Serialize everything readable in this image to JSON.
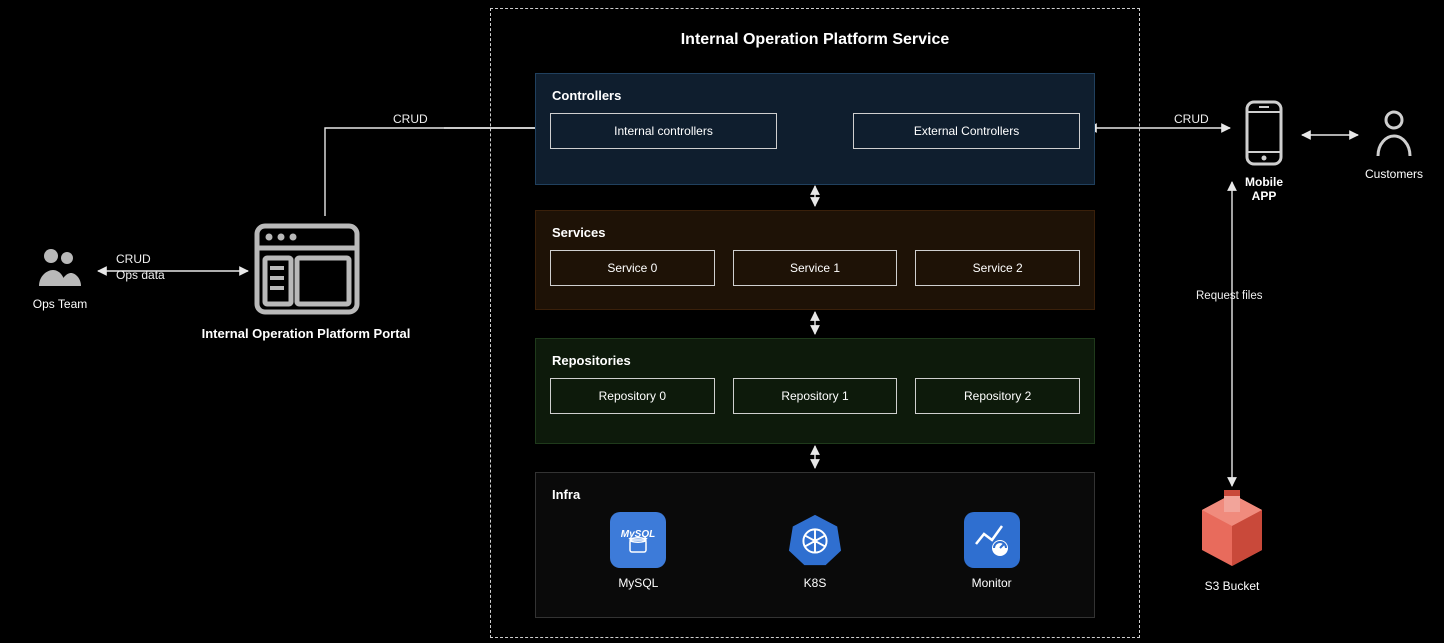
{
  "title": "Internal Operation Platform Service",
  "layers": {
    "controllers": {
      "title": "Controllers",
      "items": [
        "Internal controllers",
        "External Controllers"
      ]
    },
    "services": {
      "title": "Services",
      "items": [
        "Service 0",
        "Service 1",
        "Service 2"
      ]
    },
    "repositories": {
      "title": "Repositories",
      "items": [
        "Repository 0",
        "Repository 1",
        "Repository 2"
      ]
    },
    "infra": {
      "title": "Infra",
      "items": [
        "MySQL",
        "K8S",
        "Monitor"
      ]
    }
  },
  "nodes": {
    "ops_team": "Ops Team",
    "portal": "Internal Operation Platform Portal",
    "mobile": "Mobile APP",
    "customers": "Customers",
    "s3": "S3 Bucket"
  },
  "edges": {
    "ops_crud": "CRUD",
    "ops_data": "Ops data",
    "portal_crud": "CRUD",
    "mobile_crud": "CRUD",
    "request_files": "Request files"
  }
}
